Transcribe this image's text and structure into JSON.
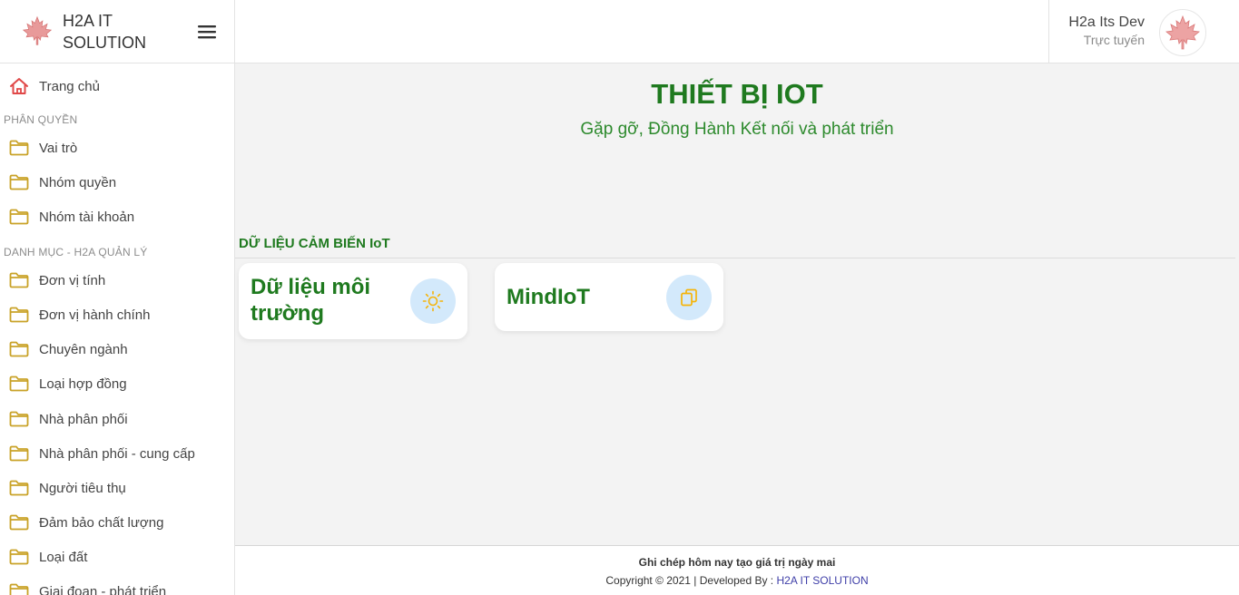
{
  "brand": {
    "name": "H2A IT SOLUTION"
  },
  "user": {
    "name": "H2a Its Dev",
    "status": "Trực tuyến"
  },
  "sidebar": {
    "home": "Trang chủ",
    "sections": [
      {
        "title": "PHÂN QUYỀN",
        "items": [
          "Vai trò",
          "Nhóm quyền",
          "Nhóm tài khoản"
        ]
      },
      {
        "title": "DANH MỤC - H2A QUẢN LÝ",
        "items": [
          "Đơn vị tính",
          "Đơn vị hành chính",
          "Chuyên ngành",
          "Loại hợp đồng",
          "Nhà phân phối",
          "Nhà phân phối - cung cấp",
          "Người tiêu thụ",
          "Đảm bảo chất lượng",
          "Loại đất",
          "Giai đoạn - phát triển"
        ]
      }
    ]
  },
  "main": {
    "title": "THIẾT BỊ IOT",
    "subtitle": "Gặp gỡ, Đồng Hành Kết nối và phát triển",
    "section_heading": "DỮ LIỆU CẢM BIẾN IoT",
    "cards": [
      {
        "title": "Dữ liệu môi trường",
        "icon": "sun-icon"
      },
      {
        "title": "MindIoT",
        "icon": "copy-icon"
      }
    ]
  },
  "footer": {
    "tagline": "Ghi chép hôm nay tạo giá trị ngày mai",
    "copyright_prefix": "Copyright © 2021 | Developed By :",
    "developer": "H2A IT SOLUTION"
  },
  "colors": {
    "brand_green": "#1f7a1f",
    "folder_icon": "#c9a227",
    "home_icon": "#e04848",
    "card_icon_bg": "#d3e9fb",
    "card_icon": "#f5b40a",
    "link": "#3f3fa8"
  }
}
